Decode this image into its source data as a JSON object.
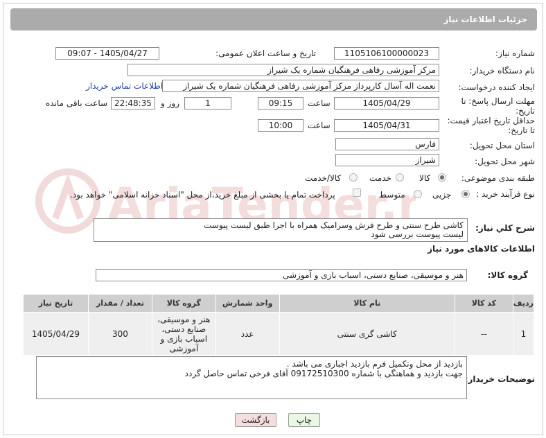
{
  "header": {
    "title": "جزئیات اطلاعات نیاز"
  },
  "fields": {
    "need_number_label": "شماره نیاز:",
    "need_number": "1105106100000023",
    "announce_label": "تاریخ و ساعت اعلان عمومی:",
    "announce_value": "1405/04/27 - 09:07",
    "buyer_org_label": "نام دستگاه خریدار:",
    "buyer_org": "مرکز آموزشی رفاهی فرهنگیان شماره یک شیراز",
    "requester_label": "ایجاد کننده درخواست:",
    "requester": "نعمت اله آسال کارپرداز مرکز آموزشی رفاهی فرهنگیان شماره یک شیراز",
    "contact_link": "اطلاعات تماس خریدار",
    "deadline_label": "مهلت ارسال پاسخ: تا تاریخ:",
    "deadline_date": "1405/04/29",
    "time_label": "ساعت",
    "deadline_time": "09:15",
    "days_value": "1",
    "days_label": "روز و",
    "remaining_time": "22:48:35",
    "remaining_label": "ساعت باقی مانده",
    "min_price_label": "حداقل تاریخ اعتبار قیمت: تا تاریخ:",
    "min_price_date": "1405/04/31",
    "min_price_time": "10:00",
    "province_label": "استان محل تحویل:",
    "province": "فارس",
    "city_label": "شهر محل تحویل:",
    "city": "شیراز",
    "category_label": "طبقه بندی موضوعی:",
    "category_options": [
      "کالا",
      "خدمت",
      "کالا/خدمت"
    ],
    "category_selected": "کالا",
    "process_label": "نوع فرآیند خرید :",
    "process_options": [
      "جزیی",
      "متوسط"
    ],
    "process_selected": "جزیی",
    "payment_note": "پرداخت تمام یا بخشی از مبلغ خرید،از محل \"اسناد خزانه اسلامی\" خواهد بود."
  },
  "description": {
    "label": "شرح کلي نياز:",
    "text": "کاشی طرح سنتی و طرح فرش  وسرامیک همراه با اجرا طبق لیست پیوست\nلیست پیوست بررسی شود"
  },
  "goods": {
    "section_title": "اطلاعات کالاهای مورد نیاز",
    "group_label": "گروه کالا:",
    "group_value": "هنر و موسیقی، صنایع دستی، اسباب بازی و آموزشی",
    "columns": [
      "ردیف",
      "کد کالا",
      "نام کالا",
      "واحد شمارش",
      "گروه کالا",
      "تعداد / مقدار",
      "تاریخ نیاز"
    ],
    "rows": [
      {
        "row": "1",
        "code": "--",
        "name": "کاشی گری سنتی",
        "unit": "عدد",
        "group": "هنر و موسیقی، صنایع دستی، اسباب بازی و آموزشی",
        "qty": "300",
        "date": "1405/04/29"
      }
    ]
  },
  "buyer_notes": {
    "label": "توضیحات خریدار:",
    "text": "بازدید از محل وتکمیل فرم بازدید اجباری می باشد .\nجهت بازدید و  هماهنگی با شماره 09172510300 آقای فرخی تماس حاصل گردد"
  },
  "actions": {
    "print_label": "چاپ",
    "back_label": "بازگشت"
  },
  "watermark": {
    "text": "AriaTender.neT"
  },
  "colors": {
    "title_bg": "#ababab",
    "link": "#1a3fa8",
    "back_btn": "#f7dede",
    "print_btn": "#eaf7e4",
    "watermark": "#f0d8d8"
  }
}
